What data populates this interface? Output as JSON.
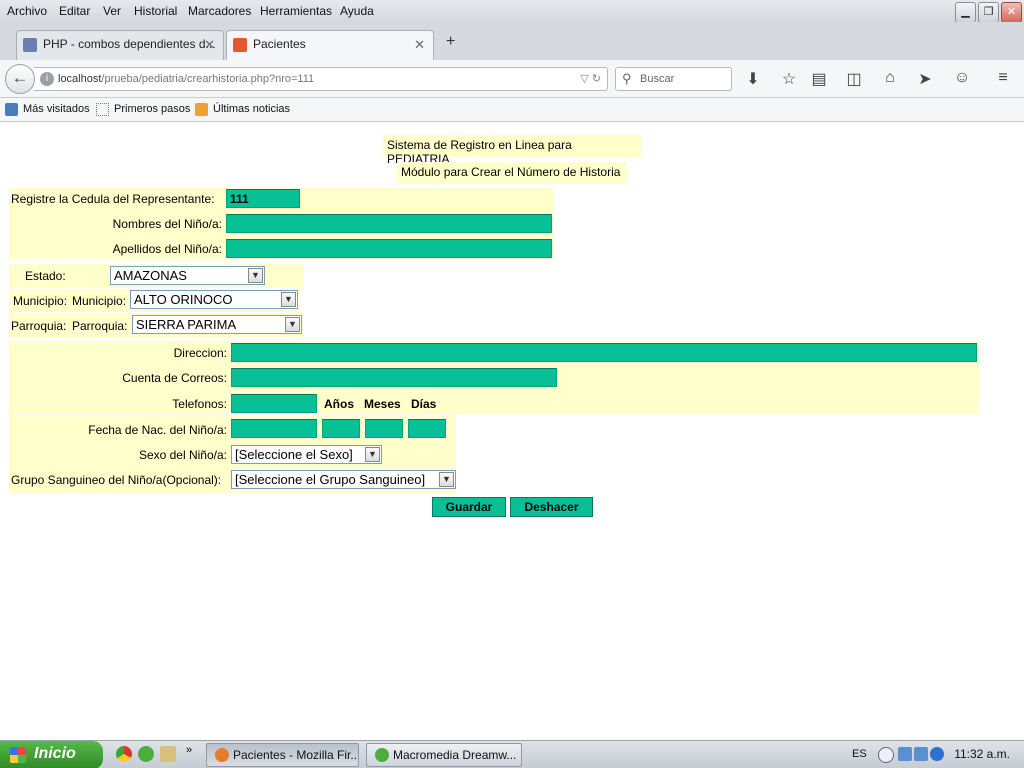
{
  "menu": [
    "Archivo",
    "Editar",
    "Ver",
    "Historial",
    "Marcadores",
    "Herramientas",
    "Ayuda"
  ],
  "tabs": [
    {
      "label": "PHP - combos dependientes d...",
      "active": false
    },
    {
      "label": "Pacientes",
      "active": true
    }
  ],
  "nav": {
    "url_host": "localhost",
    "url_path": "/prueba/pediatria/crearhistoria.php?nro=111",
    "search_placeholder": "Buscar"
  },
  "bookmarks": [
    "Más visitados",
    "Primeros pasos",
    "Últimas noticias"
  ],
  "page": {
    "title1": "Sistema de Registro en Linea para PEDIATRIA",
    "title2": "Módulo para Crear el Número de Historia",
    "cedula_label": "Registre la Cedula del Representante:",
    "cedula_value": "111",
    "nombres_label": "Nombres del Niño/a:",
    "apellidos_label": "Apellidos del Niño/a:",
    "estado_label": "Estado:",
    "estado_value": "AMAZONAS",
    "municipio_label": "Municipio:",
    "municipio_label2": "Municipio:",
    "municipio_value": "ALTO ORINOCO",
    "parroquia_label": "Parroquia:",
    "parroquia_label2": "Parroquia:",
    "parroquia_value": "SIERRA PARIMA",
    "direccion_label": "Direccion:",
    "correo_label": "Cuenta de Correos:",
    "telefonos_label": "Telefonos:",
    "anios": "Años",
    "meses": "Meses",
    "dias": "Días",
    "fecha_label": "Fecha de Nac. del Niño/a:",
    "sexo_label": "Sexo del Niño/a:",
    "sexo_value": "[Seleccione el Sexo]",
    "grupo_label": "Grupo Sanguineo del Niño/a(Opcional):",
    "grupo_value": "[Seleccione el Grupo Sanguineo]",
    "guardar": "Guardar",
    "deshacer": "Deshacer"
  },
  "taskbar": {
    "start": "Inicio",
    "tasks": [
      "Pacientes - Mozilla Fir...",
      "Macromedia Dreamw..."
    ],
    "lang": "ES",
    "clock": "11:32 a.m."
  },
  "colors": {
    "field": "#08c096",
    "row_bg": "#ffffcc"
  }
}
